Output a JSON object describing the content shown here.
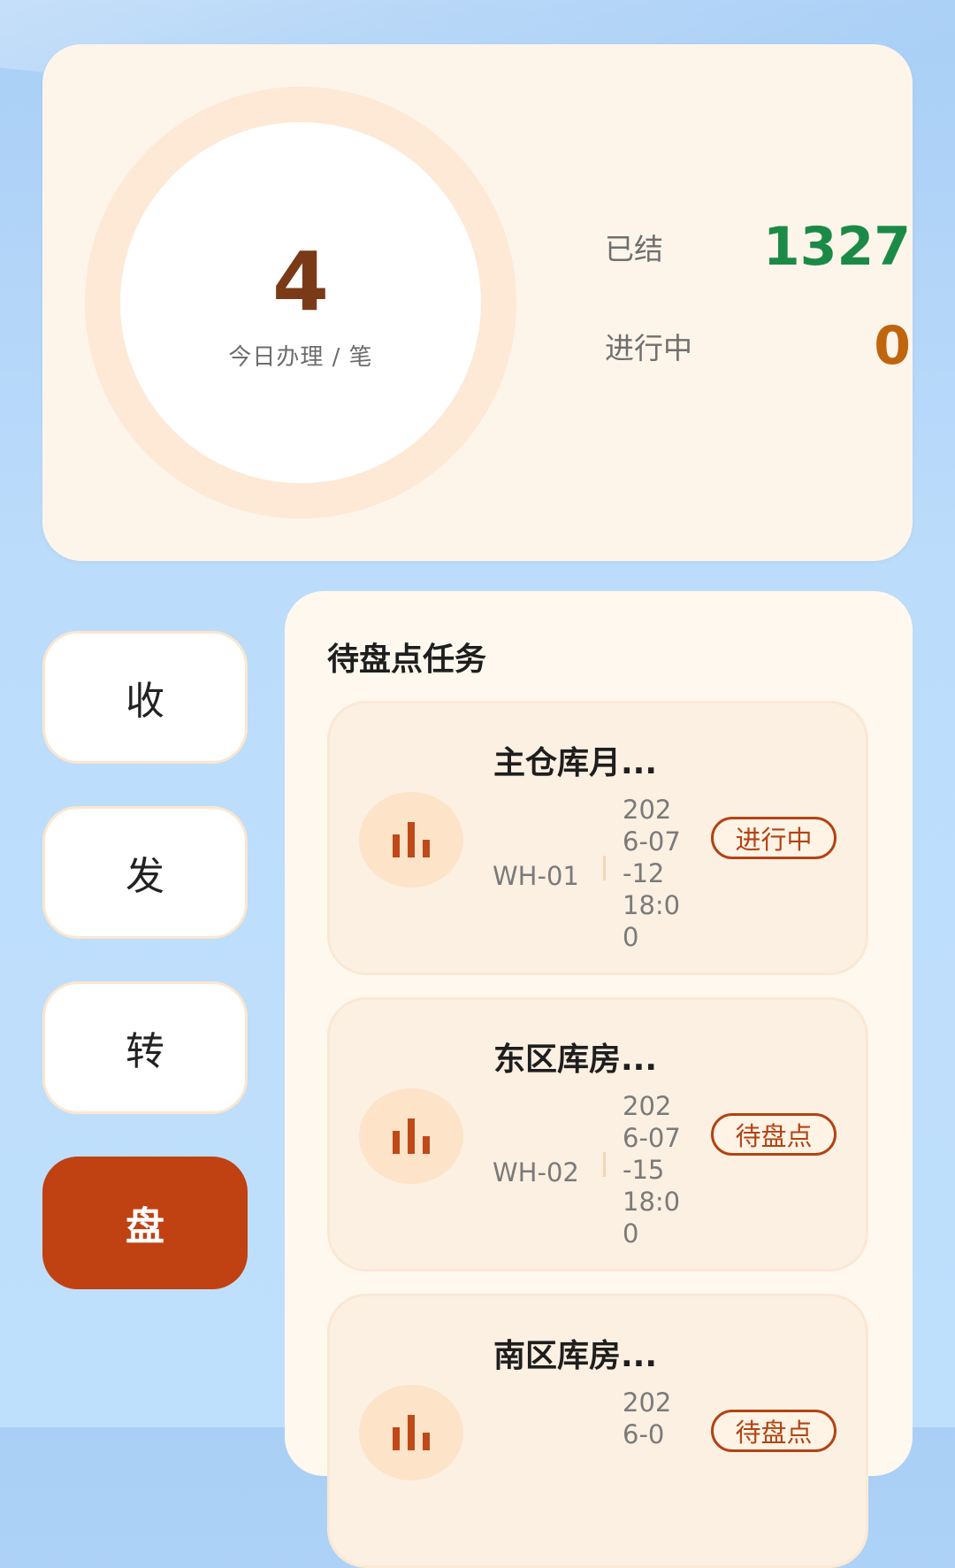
{
  "summary": {
    "today_count": "4",
    "today_label": "今日办理 / 笔",
    "done_label": "已结",
    "done_value": "1327",
    "in_progress_label": "进行中",
    "in_progress_value": "0"
  },
  "side_nav": [
    {
      "label": "收",
      "active": false
    },
    {
      "label": "发",
      "active": false
    },
    {
      "label": "转",
      "active": false
    },
    {
      "label": "盘",
      "active": true
    }
  ],
  "task_panel": {
    "title": "待盘点任务",
    "tasks": [
      {
        "title": "主仓库月...",
        "icon": "bar-chart-icon",
        "code": "WH-01",
        "date": "2026-07-12 18:00",
        "status": "进行中"
      },
      {
        "title": "东区库房...",
        "icon": "bar-chart-icon",
        "code": "WH-02",
        "date": "2026-07-15 18:00",
        "status": "待盘点"
      },
      {
        "title": "南区库房...",
        "icon": "bar-chart-icon",
        "code": "",
        "date": "2026-0",
        "status": "待盘点"
      }
    ]
  },
  "colors": {
    "accent": "#c04112",
    "done_green": "#1c8a47",
    "progress_orange": "#c0650f",
    "today_brown": "#7a3a17"
  }
}
